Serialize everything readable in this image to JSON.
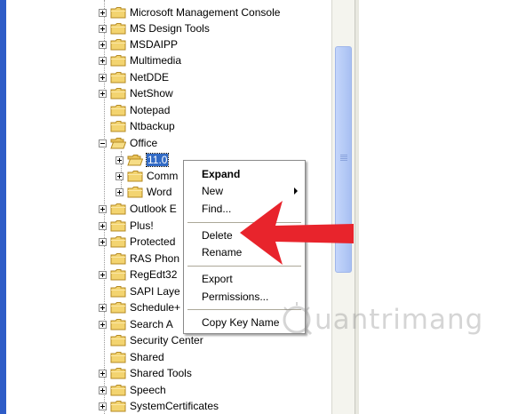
{
  "registry_tree": {
    "items": [
      {
        "label": "Microsoft Management Console",
        "expander": "plus"
      },
      {
        "label": "MS Design Tools",
        "expander": "plus"
      },
      {
        "label": "MSDAIPP",
        "expander": "plus"
      },
      {
        "label": "Multimedia",
        "expander": "plus"
      },
      {
        "label": "NetDDE",
        "expander": "plus"
      },
      {
        "label": "NetShow",
        "expander": "plus"
      },
      {
        "label": "Notepad",
        "expander": "none"
      },
      {
        "label": "Ntbackup",
        "expander": "none"
      },
      {
        "label": "Office",
        "expander": "minus"
      },
      {
        "label": "11.0",
        "expander": "plus",
        "selected": true
      },
      {
        "label": "Comm",
        "expander": "plus"
      },
      {
        "label": "Word",
        "expander": "plus"
      },
      {
        "label": "Outlook E",
        "expander": "plus"
      },
      {
        "label": "Plus!",
        "expander": "plus"
      },
      {
        "label": "Protected",
        "expander": "plus"
      },
      {
        "label": "RAS Phon",
        "expander": "none"
      },
      {
        "label": "RegEdt32",
        "expander": "plus"
      },
      {
        "label": "SAPI Laye",
        "expander": "none"
      },
      {
        "label": "Schedule+",
        "expander": "plus"
      },
      {
        "label": "Search A",
        "expander": "plus"
      },
      {
        "label": "Security Center",
        "expander": "none"
      },
      {
        "label": "Shared",
        "expander": "none"
      },
      {
        "label": "Shared Tools",
        "expander": "plus"
      },
      {
        "label": "Speech",
        "expander": "plus"
      },
      {
        "label": "SystemCertificates",
        "expander": "plus"
      }
    ]
  },
  "context_menu": {
    "expand": "Expand",
    "new": "New",
    "find": "Find...",
    "delete": "Delete",
    "rename": "Rename",
    "export": "Export",
    "permissions": "Permissions...",
    "copy_key_name": "Copy Key Name"
  },
  "watermark": {
    "text": "uantrimang"
  },
  "colors": {
    "selection": "#316ac5",
    "folder": "#f3d470",
    "arrow": "#e8242c",
    "scroll_thumb": "#b6cbf6",
    "left_strip": "#2e5cc7"
  }
}
